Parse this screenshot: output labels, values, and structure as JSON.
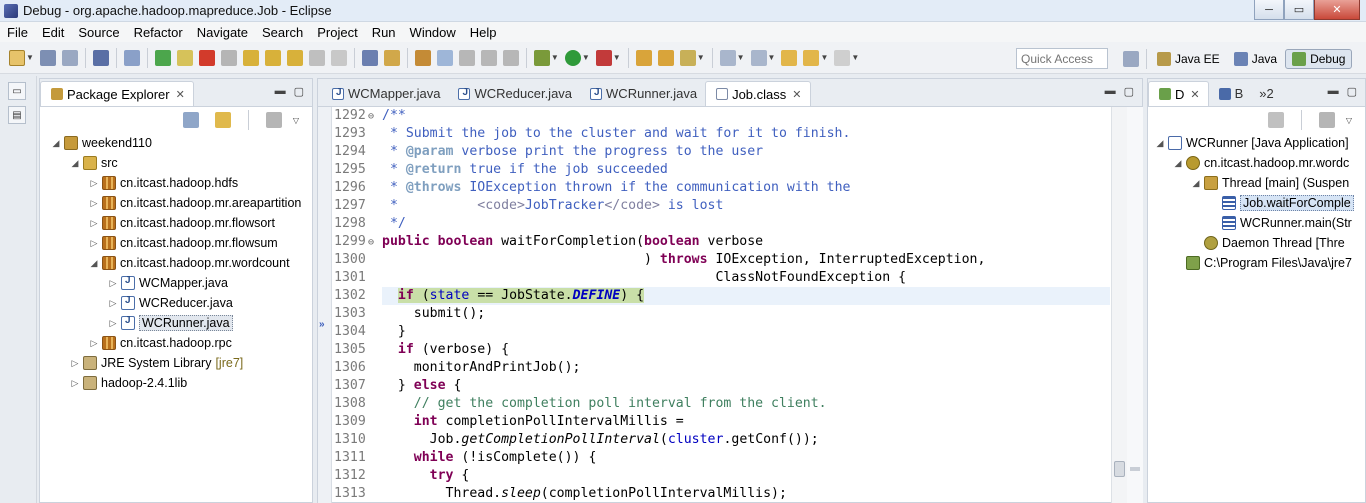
{
  "window": {
    "title": "Debug - org.apache.hadoop.mapreduce.Job - Eclipse",
    "controls": {
      "minimize": "─",
      "maximize": "▭",
      "close": "✕"
    }
  },
  "menu": [
    "File",
    "Edit",
    "Source",
    "Refactor",
    "Navigate",
    "Search",
    "Project",
    "Run",
    "Window",
    "Help"
  ],
  "toolbar": {
    "quick_access_placeholder": "Quick Access",
    "perspectives": [
      {
        "label": "Java EE",
        "active": false
      },
      {
        "label": "Java",
        "active": false
      },
      {
        "label": "Debug",
        "active": true
      }
    ]
  },
  "package_explorer": {
    "tab_label": "Package Explorer",
    "tree": [
      {
        "label": "weekend110",
        "level": 0,
        "twisty": "◢",
        "icon": "project"
      },
      {
        "label": "src",
        "level": 1,
        "twisty": "◢",
        "icon": "src"
      },
      {
        "label": "cn.itcast.hadoop.hdfs",
        "level": 2,
        "twisty": "▷",
        "icon": "pkg"
      },
      {
        "label": "cn.itcast.hadoop.mr.areapartition",
        "level": 2,
        "twisty": "▷",
        "icon": "pkg"
      },
      {
        "label": "cn.itcast.hadoop.mr.flowsort",
        "level": 2,
        "twisty": "▷",
        "icon": "pkg"
      },
      {
        "label": "cn.itcast.hadoop.mr.flowsum",
        "level": 2,
        "twisty": "▷",
        "icon": "pkg"
      },
      {
        "label": "cn.itcast.hadoop.mr.wordcount",
        "level": 2,
        "twisty": "◢",
        "icon": "pkg"
      },
      {
        "label": "WCMapper.java",
        "level": 3,
        "twisty": "▷",
        "icon": "java"
      },
      {
        "label": "WCReducer.java",
        "level": 3,
        "twisty": "▷",
        "icon": "java"
      },
      {
        "label": "WCRunner.java",
        "level": 3,
        "twisty": "▷",
        "icon": "java",
        "selected": true
      },
      {
        "label": "cn.itcast.hadoop.rpc",
        "level": 2,
        "twisty": "▷",
        "icon": "pkg"
      },
      {
        "label": "JRE System Library",
        "decor": "[jre7]",
        "level": 1,
        "twisty": "▷",
        "icon": "lib"
      },
      {
        "label": "hadoop-2.4.1lib",
        "level": 1,
        "twisty": "▷",
        "icon": "lib"
      }
    ]
  },
  "editor": {
    "tabs": [
      {
        "label": "WCMapper.java",
        "active": false
      },
      {
        "label": "WCReducer.java",
        "active": false
      },
      {
        "label": "WCRunner.java",
        "active": false
      },
      {
        "label": "Job.class",
        "active": true
      }
    ],
    "current_line": 1302,
    "lines": [
      {
        "n": "1292",
        "fold": "⊖",
        "segs": [
          [
            "jd",
            "/**"
          ]
        ]
      },
      {
        "n": "1293",
        "segs": [
          [
            "jd",
            " * Submit the job to the cluster and wait for it to finish."
          ]
        ]
      },
      {
        "n": "1294",
        "segs": [
          [
            "jd",
            " * "
          ],
          [
            "jdtag",
            "@param"
          ],
          [
            "jd",
            " verbose print the progress to the user"
          ]
        ]
      },
      {
        "n": "1295",
        "segs": [
          [
            "jd",
            " * "
          ],
          [
            "jdtag",
            "@return"
          ],
          [
            "jd",
            " true if the job succeeded"
          ]
        ]
      },
      {
        "n": "1296",
        "segs": [
          [
            "jd",
            " * "
          ],
          [
            "jdtag",
            "@throws"
          ],
          [
            "jd",
            " IOException thrown if the communication with the"
          ]
        ]
      },
      {
        "n": "1297",
        "segs": [
          [
            "jd",
            " *          "
          ],
          [
            "jdhtml",
            "<code>"
          ],
          [
            "jd",
            "JobTracker"
          ],
          [
            "jdhtml",
            "</code>"
          ],
          [
            "jd",
            " is lost"
          ]
        ]
      },
      {
        "n": "1298",
        "segs": [
          [
            "jd",
            " */"
          ]
        ]
      },
      {
        "n": "1299",
        "fold": "⊖",
        "segs": [
          [
            "kw",
            "public"
          ],
          [
            "",
            " "
          ],
          [
            "kw",
            "boolean"
          ],
          [
            "",
            " waitForCompletion("
          ],
          [
            "kw",
            "boolean"
          ],
          [
            "",
            " verbose"
          ]
        ]
      },
      {
        "n": "1300",
        "segs": [
          [
            "",
            "                                 ) "
          ],
          [
            "kw",
            "throws"
          ],
          [
            "",
            " IOException, InterruptedException,"
          ]
        ]
      },
      {
        "n": "1301",
        "segs": [
          [
            "",
            "                                          ClassNotFoundException {"
          ]
        ]
      },
      {
        "n": "1302",
        "current": true,
        "segs": [
          [
            "",
            "  "
          ],
          [
            "kwhl",
            "if"
          ],
          [
            "hl",
            " ("
          ],
          [
            "fldhl",
            "state"
          ],
          [
            "hl",
            " == JobState."
          ],
          [
            "fiHL",
            "DEFINE"
          ],
          [
            "hl",
            ") {"
          ]
        ]
      },
      {
        "n": "1303",
        "segs": [
          [
            "",
            "    submit();"
          ]
        ]
      },
      {
        "n": "1304",
        "segs": [
          [
            "",
            "  }"
          ]
        ]
      },
      {
        "n": "1305",
        "segs": [
          [
            "",
            "  "
          ],
          [
            "kw",
            "if"
          ],
          [
            "",
            " (verbose) {"
          ]
        ]
      },
      {
        "n": "1306",
        "segs": [
          [
            "",
            "    monitorAndPrintJob();"
          ]
        ]
      },
      {
        "n": "1307",
        "segs": [
          [
            "",
            "  } "
          ],
          [
            "kw",
            "else"
          ],
          [
            "",
            " {"
          ]
        ]
      },
      {
        "n": "1308",
        "segs": [
          [
            "cm",
            "    // get the completion poll interval from the client."
          ]
        ]
      },
      {
        "n": "1309",
        "segs": [
          [
            "",
            "    "
          ],
          [
            "kw",
            "int"
          ],
          [
            "",
            " completionPollIntervalMillis ="
          ]
        ]
      },
      {
        "n": "1310",
        "segs": [
          [
            "",
            "      Job."
          ],
          [
            "itl",
            "getCompletionPollInterval"
          ],
          [
            "",
            "("
          ],
          [
            "fld",
            "cluster"
          ],
          [
            "",
            ".getConf());"
          ]
        ]
      },
      {
        "n": "1311",
        "segs": [
          [
            "",
            "    "
          ],
          [
            "kw",
            "while"
          ],
          [
            "",
            " (!isComplete()) {"
          ]
        ]
      },
      {
        "n": "1312",
        "segs": [
          [
            "",
            "      "
          ],
          [
            "kw",
            "try"
          ],
          [
            "",
            " {"
          ]
        ]
      },
      {
        "n": "1313",
        "segs": [
          [
            "",
            "        Thread."
          ],
          [
            "itl",
            "sleep"
          ],
          [
            "",
            "(completionPollIntervalMillis);"
          ]
        ]
      }
    ]
  },
  "debug_view": {
    "tabs": [
      {
        "label": "D",
        "active": true
      },
      {
        "label": "B",
        "active": false
      },
      {
        "label": "»2",
        "active": false
      }
    ],
    "tree": [
      {
        "label": "WCRunner [Java Application]",
        "level": 0,
        "twisty": "◢",
        "icon": "launch"
      },
      {
        "label": "cn.itcast.hadoop.mr.wordc",
        "level": 1,
        "twisty": "◢",
        "icon": "vm"
      },
      {
        "label": "Thread [main] (Suspen",
        "level": 2,
        "twisty": "◢",
        "icon": "thread"
      },
      {
        "label": "Job.waitForComple",
        "level": 3,
        "twisty": "",
        "icon": "frame",
        "selected": true
      },
      {
        "label": "WCRunner.main(Str",
        "level": 3,
        "twisty": "",
        "icon": "frame"
      },
      {
        "label": "Daemon Thread [Thre",
        "level": 2,
        "twisty": "",
        "icon": "daemon"
      },
      {
        "label": "C:\\Program Files\\Java\\jre7",
        "level": 1,
        "twisty": "",
        "icon": "proc"
      }
    ]
  }
}
